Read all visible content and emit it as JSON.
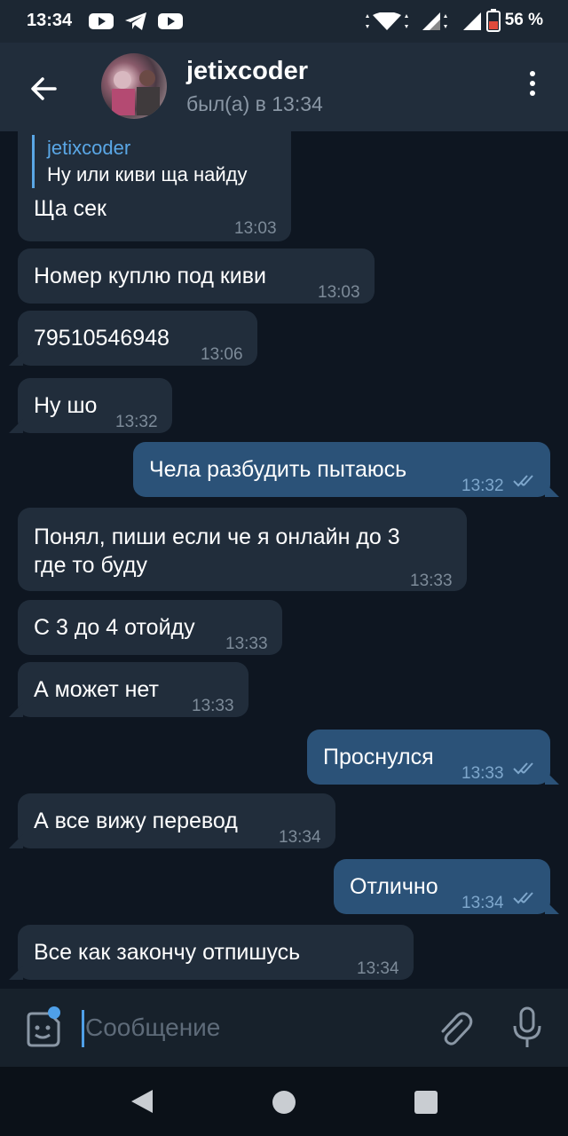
{
  "status_bar": {
    "time": "13:34",
    "battery": "56 %"
  },
  "header": {
    "title": "jetixcoder",
    "subtitle": "был(а) в 13:34"
  },
  "messages": [
    {
      "reply_name": "jetixcoder",
      "reply_text": "Ну или киви ща найду",
      "text": "Ща сек",
      "time": "13:03"
    },
    {
      "text": "Номер куплю под киви",
      "time": "13:03"
    },
    {
      "text": "79510546948",
      "time": "13:06"
    },
    {
      "text": "Ну шо",
      "time": "13:32"
    },
    {
      "text": "Чела разбудить пытаюсь",
      "time": "13:32"
    },
    {
      "text_line1": "Понял, пиши если че я онлайн до 3",
      "text_line2": "где то буду",
      "time": "13:33"
    },
    {
      "text": "С 3 до 4 отойду",
      "time": "13:33"
    },
    {
      "text": "А может нет",
      "time": "13:33"
    },
    {
      "text": "Проснулся",
      "time": "13:33"
    },
    {
      "text": "А все вижу перевод",
      "time": "13:34"
    },
    {
      "text": "Отлично",
      "time": "13:34"
    },
    {
      "text": "Все как закончу отпишусь",
      "time": "13:34"
    }
  ],
  "input": {
    "placeholder": "Сообщение"
  },
  "colors": {
    "accent": "#5aa7e6",
    "incoming": "#212d3b",
    "outgoing": "#2b5278",
    "background": "#0e1621"
  }
}
